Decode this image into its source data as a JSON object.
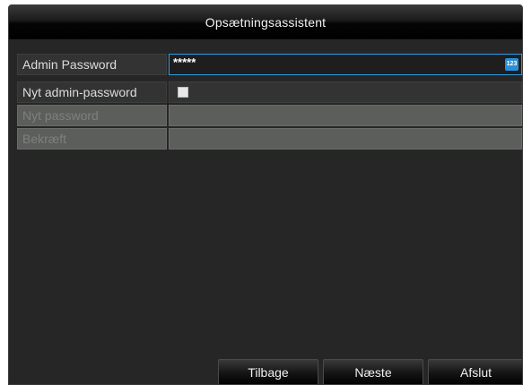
{
  "window": {
    "title": "Opsætningsassistent"
  },
  "form": {
    "admin_password": {
      "label": "Admin Password",
      "value": "*****",
      "keyboard_icon_text": "123"
    },
    "new_admin_password": {
      "label": "Nyt admin-password",
      "checked": false
    },
    "new_password": {
      "label": "Nyt password",
      "value": ""
    },
    "confirm": {
      "label": "Bekræft",
      "value": ""
    }
  },
  "buttons": {
    "back": "Tilbage",
    "next": "Næste",
    "exit": "Afslut"
  },
  "colors": {
    "background": "#262626",
    "accent": "#2f9be0",
    "disabled_row": "#5c5e5b"
  }
}
